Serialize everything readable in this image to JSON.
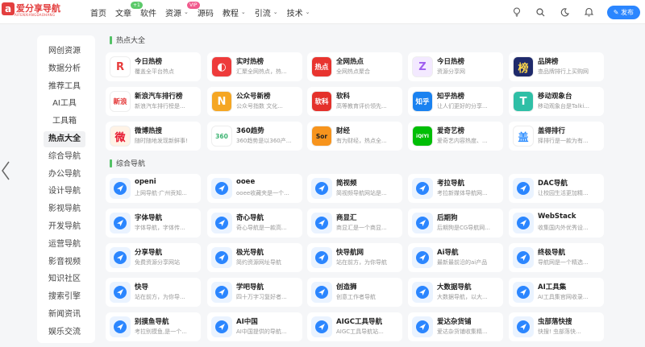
{
  "site": {
    "logo_char": "a",
    "logo_name": "爱分享导航",
    "logo_tagline": "AIFENXIANGDAOHANG"
  },
  "nav": {
    "items": [
      {
        "label": "首页",
        "has_chevron": false
      },
      {
        "label": "文章",
        "has_chevron": false,
        "badge": "+1"
      },
      {
        "label": "软件",
        "has_chevron": false
      },
      {
        "label": "资源",
        "has_chevron": true,
        "badge": "VIP"
      },
      {
        "label": "源码",
        "has_chevron": false
      },
      {
        "label": "教程",
        "has_chevron": true
      },
      {
        "label": "引流",
        "has_chevron": true
      },
      {
        "label": "技术",
        "has_chevron": true
      }
    ],
    "chevron": "⌄",
    "post_button": "发布"
  },
  "top_icons": [
    "lightbulb-icon",
    "search-icon",
    "moon-icon",
    "bell-icon"
  ],
  "sidebar": {
    "items": [
      "网创资源",
      "数据分析",
      "推荐工具",
      "AI工具",
      "工具箱",
      "热点大全",
      "综合导航",
      "办公导航",
      "设计导航",
      "影视导航",
      "开发导航",
      "运营导航",
      "影音视频",
      "知识社区",
      "搜索引擎",
      "新闻资讯",
      "娱乐交流"
    ],
    "active_index": 5
  },
  "sections": [
    {
      "title": "热点大全",
      "cards": [
        {
          "title": "今日热榜",
          "desc": "覆盖全平台热点",
          "icon_text": "R",
          "icon_bg": "#ffffff",
          "icon_color": "#e73c3c"
        },
        {
          "title": "实时热榜",
          "desc": "汇聚全网热点，热...",
          "icon_text": "◐",
          "icon_bg": "#ee3b3b",
          "icon_color": "#ffffff"
        },
        {
          "title": "全网热点",
          "desc": "全网热点聚合",
          "icon_text": "热点",
          "icon_bg": "#e8342f",
          "icon_color": "#ffffff"
        },
        {
          "title": "今日热榜",
          "desc": "资源分享网",
          "icon_text": "Z",
          "icon_bg": "#f3e9ff",
          "icon_color": "#9f5cf0"
        },
        {
          "title": "品牌榜",
          "desc": "查品牌排行上买购网",
          "icon_text": "榜",
          "icon_bg": "#1f2a6b",
          "icon_color": "#ffd84a"
        },
        {
          "title": "新浪汽车排行榜",
          "desc": "新浪汽车排行榜是...",
          "icon_text": "新浪",
          "icon_bg": "#ffffff",
          "icon_color": "#e33333"
        },
        {
          "title": "公众号新榜",
          "desc": "公众号指数 文化...",
          "icon_text": "N",
          "icon_bg": "#f5a623",
          "icon_color": "#ffffff"
        },
        {
          "title": "软科",
          "desc": "高等教育评价领先...",
          "icon_text": "软科",
          "icon_bg": "#e4312b",
          "icon_color": "#ffffff"
        },
        {
          "title": "知乎热榜",
          "desc": "让人们更好的分享...",
          "icon_text": "知乎",
          "icon_bg": "#1a82f0",
          "icon_color": "#ffffff"
        },
        {
          "title": "移动观象台",
          "desc": "移动观象台是Talki...",
          "icon_text": "T",
          "icon_bg": "#2fbfa6",
          "icon_color": "#ffffff"
        },
        {
          "title": "微博热搜",
          "desc": "随时随地发现新鲜事!",
          "icon_text": "微",
          "icon_bg": "#fff3e6",
          "icon_color": "#e6162d"
        },
        {
          "title": "360趋势",
          "desc": "360趋势是以360产...",
          "icon_text": "360",
          "icon_bg": "#ffffff",
          "icon_color": "#3cb371"
        },
        {
          "title": "财经",
          "desc": "有为财经，热点全...",
          "icon_text": "Sor",
          "icon_bg": "#f7941d",
          "icon_color": "#222222"
        },
        {
          "title": "爱奇艺榜",
          "desc": "爱奇艺内容热度、...",
          "icon_text": "iQIYI",
          "icon_bg": "#00be06",
          "icon_color": "#ffffff"
        },
        {
          "title": "盖得排行",
          "desc": "择排行是一款为有...",
          "icon_text": "盖",
          "icon_bg": "#ffffff",
          "icon_color": "#2a8cff"
        }
      ]
    },
    {
      "title": "综合导航",
      "cards": [
        {
          "title": "openi",
          "desc": "上网导航·广州贡知..."
        },
        {
          "title": "ooee",
          "desc": "ooee收藏夹是一个..."
        },
        {
          "title": "简视频",
          "desc": "简视频导航网站是..."
        },
        {
          "title": "考拉导航",
          "desc": "考拉新媒体导航网..."
        },
        {
          "title": "DAC导航",
          "desc": "让校园生活更加精..."
        },
        {
          "title": "字体导航",
          "desc": "字体导航，字体传..."
        },
        {
          "title": "奇心导航",
          "desc": "奇心导航是一款高..."
        },
        {
          "title": "商显汇",
          "desc": "商显汇是一个商显..."
        },
        {
          "title": "后期狗",
          "desc": "后期狗是CG导航网..."
        },
        {
          "title": "WebStack",
          "desc": "收集国内外优秀设..."
        },
        {
          "title": "分享导航",
          "desc": "免费资源分享网站"
        },
        {
          "title": "极光导航",
          "desc": "简约资源网址导航"
        },
        {
          "title": "快导航网",
          "desc": "站在前方，为你导航"
        },
        {
          "title": "Ai导航",
          "desc": "最新最前沿的ai产品"
        },
        {
          "title": "终极导航",
          "desc": "导航网是一个精选..."
        },
        {
          "title": "快导",
          "desc": "站在前方，为你导..."
        },
        {
          "title": "学吧导航",
          "desc": "四十万字习复好者..."
        },
        {
          "title": "创造狮",
          "desc": "创意工作者导航"
        },
        {
          "title": "大数据导航",
          "desc": "大数据导航，以大..."
        },
        {
          "title": "AI工具集",
          "desc": "AI工具集官网收录..."
        },
        {
          "title": "别摸鱼导航",
          "desc": "考拉别摸鱼,是一个..."
        },
        {
          "title": "AI中国",
          "desc": "AI中国提供的导航..."
        },
        {
          "title": "AIGC工具导航",
          "desc": "AIGC工具导航站..."
        },
        {
          "title": "爱达杂货铺",
          "desc": "爱达杂货铺收集精..."
        },
        {
          "title": "虫部落快搜",
          "desc": "快搜! 虫部落快..."
        }
      ]
    }
  ],
  "colors": {
    "accent": "#2b86ff",
    "section_bar": "#54c266",
    "nav_icon": "#2b86ff"
  }
}
